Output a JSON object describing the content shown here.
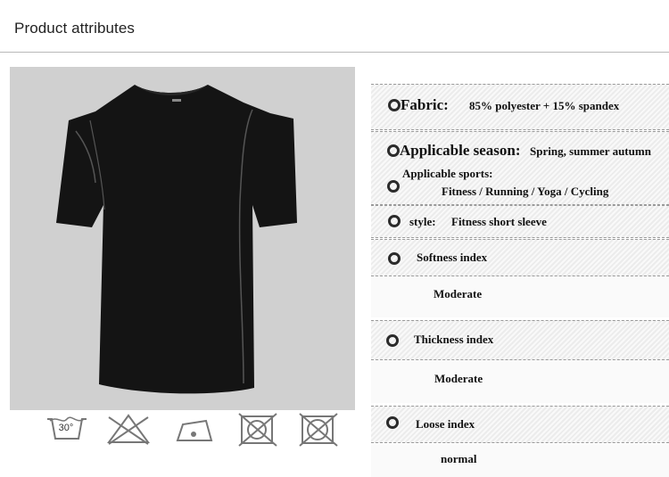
{
  "header": {
    "title": "Product attributes"
  },
  "attributes": {
    "fabric": {
      "label": "Fabric:",
      "value": "85% polyester + 15% spandex"
    },
    "season": {
      "label": "Applicable season:",
      "value": "Spring, summer autumn"
    },
    "sports": {
      "label": "Applicable sports:",
      "value": "Fitness / Running / Yoga / Cycling"
    },
    "style": {
      "label": "style:",
      "value": "Fitness short sleeve"
    },
    "softness": {
      "label": "Softness index",
      "value": "Moderate"
    },
    "thickness": {
      "label": "Thickness index",
      "value": "Moderate"
    },
    "loose": {
      "label": "Loose index",
      "value": "normal"
    }
  },
  "care": {
    "wash_temp": "30°"
  },
  "colors": {
    "shirt": "#141414",
    "piping": "#555555",
    "background": "#d0d0d0"
  }
}
